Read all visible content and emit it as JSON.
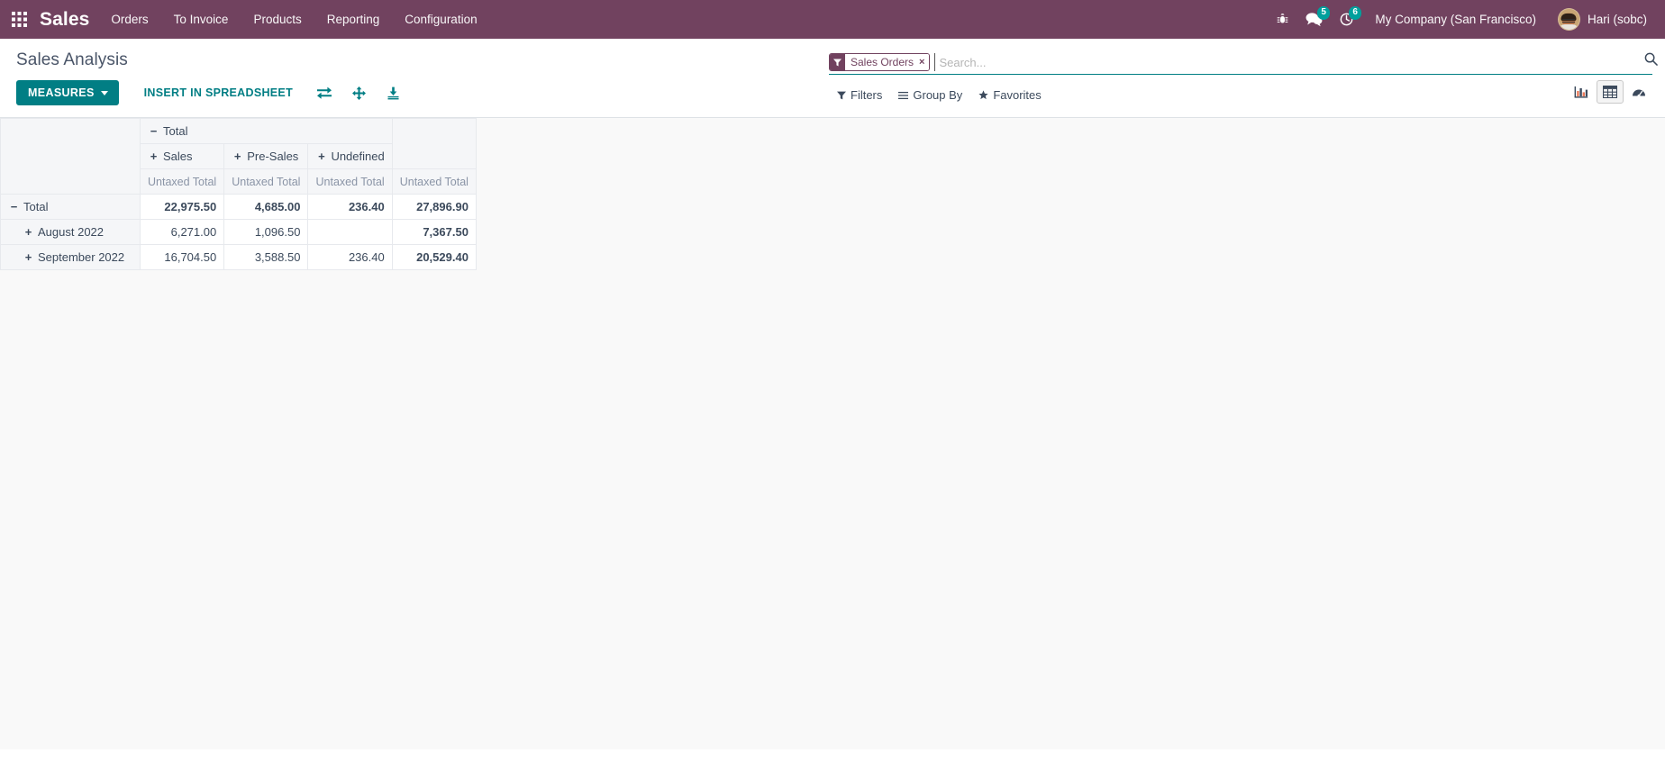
{
  "navbar": {
    "apps_icon": "apps-grid-icon",
    "brand": "Sales",
    "menu_items": [
      {
        "label": "Orders"
      },
      {
        "label": "To Invoice"
      },
      {
        "label": "Products"
      },
      {
        "label": "Reporting"
      },
      {
        "label": "Configuration"
      }
    ],
    "debug_icon": "bug-icon",
    "messages": {
      "icon": "messages-icon",
      "count": "5"
    },
    "activities": {
      "icon": "clock-activity-icon",
      "count": "6"
    },
    "company": "My Company (San Francisco)",
    "user": "Hari (sobc)",
    "colors": {
      "background": "#71425f",
      "badge": "#00a09d",
      "text": "#ffffff"
    }
  },
  "control_panel": {
    "title": "Sales Analysis",
    "measures_button": "MEASURES",
    "insert_spreadsheet_button": "INSERT IN SPREADSHEET",
    "icons": [
      {
        "name": "flip-axis-icon"
      },
      {
        "name": "expand-all-icon"
      },
      {
        "name": "download-xlsx-icon"
      }
    ],
    "search": {
      "facet": {
        "icon": "filter-funnel-icon",
        "label": "Sales Orders",
        "remove": "×"
      },
      "placeholder": "Search...",
      "value": "",
      "search_icon": "search-icon"
    },
    "dropdowns": [
      {
        "name": "filters",
        "icon": "filter-funnel-icon",
        "label": "Filters"
      },
      {
        "name": "group-by",
        "icon": "list-lines-icon",
        "label": "Group By"
      },
      {
        "name": "favorites",
        "icon": "star-icon",
        "label": "Favorites"
      }
    ],
    "view_switcher": [
      {
        "name": "graph-view",
        "icon": "bar-chart-icon",
        "active": false
      },
      {
        "name": "pivot-view",
        "icon": "pivot-table-icon",
        "active": true
      },
      {
        "name": "dashboard-view",
        "icon": "gauge-dashboard-icon",
        "active": false
      }
    ],
    "accent_color": "#017e84"
  },
  "chart_data": {
    "type": "table",
    "title": "Sales Analysis",
    "measure": "Untaxed Total",
    "column_group_root": {
      "label": "Total",
      "toggle": "−"
    },
    "column_groups": [
      {
        "label": "Sales",
        "toggle": "+"
      },
      {
        "label": "Pre-Sales",
        "toggle": "+"
      },
      {
        "label": "Undefined",
        "toggle": "+"
      }
    ],
    "measure_headers": [
      "Untaxed Total",
      "Untaxed Total",
      "Untaxed Total",
      "Untaxed Total"
    ],
    "rows": [
      {
        "label": "Total",
        "toggle": "−",
        "indent": false,
        "is_total": true,
        "values": [
          "22,975.50",
          "4,685.00",
          "236.40",
          "27,896.90"
        ]
      },
      {
        "label": "August 2022",
        "toggle": "+",
        "indent": true,
        "is_total": false,
        "values": [
          "6,271.00",
          "1,096.50",
          "",
          "7,367.50"
        ]
      },
      {
        "label": "September 2022",
        "toggle": "+",
        "indent": true,
        "is_total": false,
        "values": [
          "16,704.50",
          "3,588.50",
          "236.40",
          "20,529.40"
        ]
      }
    ],
    "categories": [
      "August 2022",
      "September 2022"
    ],
    "series": [
      {
        "name": "Sales",
        "values": [
          6271.0,
          16704.5
        ]
      },
      {
        "name": "Pre-Sales",
        "values": [
          1096.5,
          3588.5
        ]
      },
      {
        "name": "Undefined",
        "values": [
          null,
          236.4
        ]
      }
    ],
    "row_totals": [
      7367.5,
      20529.4
    ],
    "column_totals": [
      22975.5,
      4685.0,
      236.4
    ],
    "grand_total": 27896.9,
    "xlabel": "",
    "ylabel": "Untaxed Total"
  }
}
